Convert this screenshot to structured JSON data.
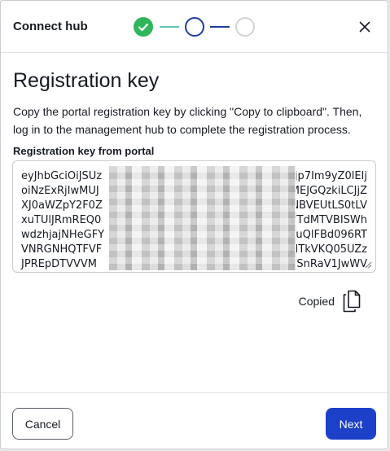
{
  "header": {
    "title": "Connect hub",
    "steps": [
      {
        "state": "completed",
        "icon": "check-icon",
        "color": "#2fb65a"
      },
      {
        "state": "current",
        "color": "#1f3c9e"
      },
      {
        "state": "upcoming",
        "color": "#cfd2d6"
      }
    ],
    "close_icon": "close-icon"
  },
  "main": {
    "heading": "Registration key",
    "description": "Copy the portal registration key by clicking \"Copy to clipboard\". Then, log in to the management hub to complete the registration process.",
    "field_label": "Registration key from portal",
    "key_lines": [
      {
        "start": "eyJhbGciOiJSUz",
        "end": "nljp7Im9yZ0lEIj"
      },
      {
        "start": "oiNzExRjIwMUJ",
        "end": "MEJGQzkiLCJjZ"
      },
      {
        "start": "XJ0aWZpY2F0Z",
        "end": "NBVEUtLS0tLV"
      },
      {
        "start": "xuTUlJRmREQ0",
        "end": "VTdMTVBISWh"
      },
      {
        "start": "wdzhjajNHeGFY",
        "end": "xuQlFBd096RT"
      },
      {
        "start": "VNRGNHQTFVF",
        "end": "HTkVKQ05UZz"
      },
      {
        "start": "JPREpDTVVVM",
        "end": "YSnRaV1JwWV"
      }
    ],
    "copy_status": "Copied",
    "copy_icon": "copy-document-icon"
  },
  "footer": {
    "cancel_label": "Cancel",
    "next_label": "Next",
    "accent": "#1d40c8"
  }
}
